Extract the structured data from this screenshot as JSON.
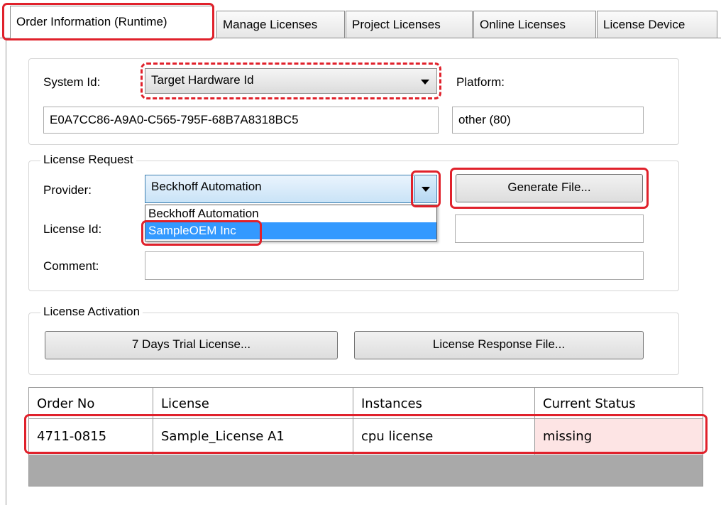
{
  "tabs": [
    {
      "label": "Order Information (Runtime)",
      "active": true
    },
    {
      "label": "Manage Licenses"
    },
    {
      "label": "Project Licenses"
    },
    {
      "label": "Online Licenses"
    },
    {
      "label": "License Device"
    }
  ],
  "system": {
    "system_id_label": "System Id:",
    "system_id_combo": "Target Hardware Id",
    "system_id_value": "E0A7CC86-A9A0-C565-795F-68B7A8318BC5",
    "platform_label": "Platform:",
    "platform_value": "other (80)"
  },
  "license_request": {
    "title": "License Request",
    "provider_label": "Provider:",
    "provider_selected": "Beckhoff Automation",
    "provider_options": [
      "Beckhoff Automation",
      "SampleOEM Inc"
    ],
    "generate_button": "Generate File...",
    "license_id_label": "License Id:",
    "license_id_value": "",
    "comment_label": "Comment:",
    "comment_value": ""
  },
  "license_activation": {
    "title": "License Activation",
    "trial_button": "7 Days Trial License...",
    "response_button": "License Response File..."
  },
  "table": {
    "columns": [
      "Order No",
      "License",
      "Instances",
      "Current Status"
    ],
    "rows": [
      {
        "order_no": "4711-0815",
        "license": "Sample_License A1",
        "instances": "cpu license",
        "status": "missing"
      }
    ]
  },
  "colors": {
    "highlight_red": "#e0212b",
    "selection_blue": "#3399ff",
    "missing_bg": "#fde4e4"
  }
}
